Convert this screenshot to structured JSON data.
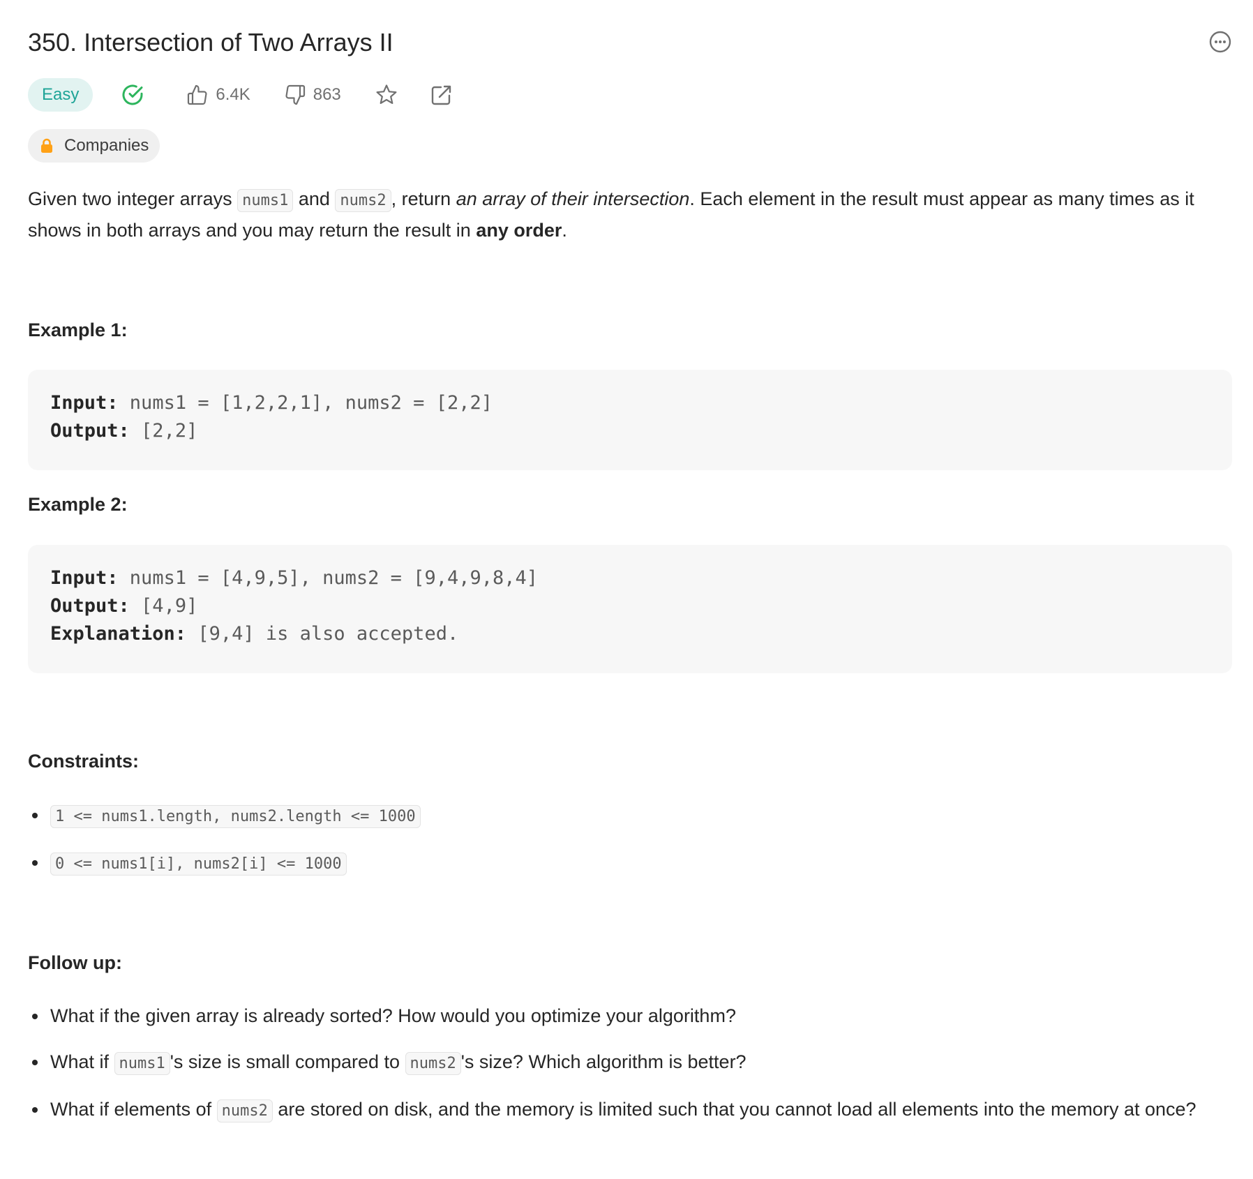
{
  "problem": {
    "title": "350. Intersection of Two Arrays II",
    "difficulty": "Easy",
    "likes": "6.4K",
    "dislikes": "863",
    "companies_label": "Companies"
  },
  "description": {
    "p1": "Given two integer arrays ",
    "code1": "nums1",
    "p2": " and ",
    "code2": "nums2",
    "p3": ", return ",
    "em": "an array of their intersection",
    "p4": ". Each element in the result must appear as many times as it shows in both arrays and you may return the result in ",
    "strong": "any order",
    "p5": "."
  },
  "examples": [
    {
      "heading": "Example 1:",
      "input_label": "Input:",
      "input": " nums1 = [1,2,2,1], nums2 = [2,2]",
      "output_label": "Output:",
      "output": " [2,2]"
    },
    {
      "heading": "Example 2:",
      "input_label": "Input:",
      "input": " nums1 = [4,9,5], nums2 = [9,4,9,8,4]",
      "output_label": "Output:",
      "output": " [4,9]",
      "explanation_label": "Explanation:",
      "explanation": " [9,4] is also accepted."
    }
  ],
  "constraints": {
    "heading": "Constraints:",
    "items": [
      "1 <= nums1.length, nums2.length <= 1000",
      "0 <= nums1[i], nums2[i] <= 1000"
    ]
  },
  "followup": {
    "heading": "Follow up:",
    "item1": "What if the given array is already sorted? How would you optimize your algorithm?",
    "item2_a": "What if ",
    "item2_code1": "nums1",
    "item2_b": "'s size is small compared to ",
    "item2_code2": "nums2",
    "item2_c": "'s size? Which algorithm is better?",
    "item3_a": "What if elements of ",
    "item3_code": "nums2",
    "item3_b": " are stored on disk, and the memory is limited such that you cannot load all elements into the memory at once?"
  },
  "colors": {
    "easy": "#1ea497",
    "easy_bg": "#e2f3f1",
    "solved": "#2db55d",
    "lock": "#ffa116"
  },
  "icons": {
    "more": "more-horizontal-circle-icon",
    "solved": "check-circle-icon",
    "like": "thumbs-up-icon",
    "dislike": "thumbs-down-icon",
    "favorite": "star-icon",
    "share": "share-icon",
    "lock": "lock-icon"
  }
}
